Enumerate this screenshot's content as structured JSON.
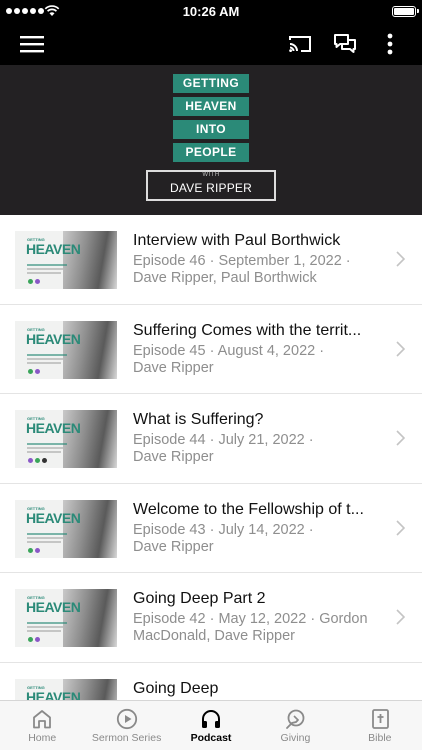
{
  "status_bar": {
    "time": "10:26 AM"
  },
  "nav": {
    "menu_icon": "hamburger-icon",
    "cast_icon": "cast-icon",
    "chat_icon": "chat-icon",
    "more_icon": "more-vertical-icon"
  },
  "hero": {
    "lines": [
      "GETTING",
      "HEAVEN",
      "INTO",
      "PEOPLE"
    ],
    "with": "WITH",
    "author": "DAVE RIPPER",
    "accent": "#2b8a78"
  },
  "episodes": [
    {
      "title": "Interview with Paul Borthwick",
      "line1": "Episode 46 · September 1, 2022 ·",
      "line2": "Dave Ripper, Paul Borthwick"
    },
    {
      "title": "Suffering Comes with the territ...",
      "line1": "Episode 45 · August 4, 2022 ·",
      "line2": "Dave Ripper"
    },
    {
      "title": "What is Suffering?",
      "line1": "Episode 44 · July 21, 2022 ·",
      "line2": "Dave Ripper"
    },
    {
      "title": "Welcome to the Fellowship of t...",
      "line1": "Episode 43 · July 14, 2022 ·",
      "line2": "Dave Ripper"
    },
    {
      "title": "Going Deep Part 2",
      "line1": "Episode 42 · May 12, 2022 · Gordon",
      "line2": "MacDonald, Dave Ripper"
    },
    {
      "title": "Going Deep",
      "line1": "",
      "line2": ""
    }
  ],
  "thumbnail": {
    "small_text": "GETTING",
    "big_text": "HEAVEN"
  },
  "tabs": [
    {
      "label": "Home",
      "icon": "home-icon"
    },
    {
      "label": "Sermon Series",
      "icon": "play-circle-icon"
    },
    {
      "label": "Podcast",
      "icon": "headphones-icon",
      "active": true
    },
    {
      "label": "Giving",
      "icon": "giving-icon"
    },
    {
      "label": "Bible",
      "icon": "bible-icon"
    }
  ]
}
